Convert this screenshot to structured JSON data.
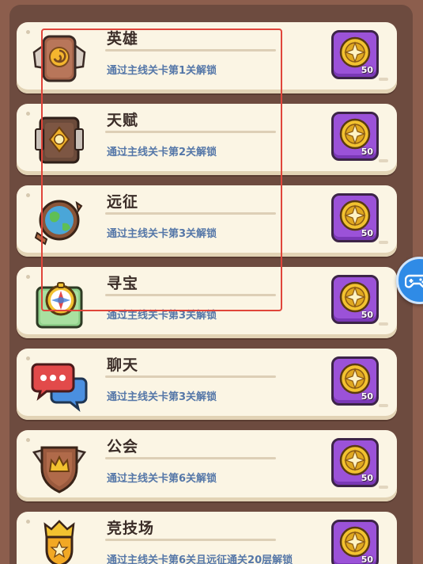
{
  "features": [
    {
      "name": "英雄",
      "desc": "通过主线关卡第1关解锁",
      "icon": "hero-icon",
      "reward_count": "50"
    },
    {
      "name": "天赋",
      "desc": "通过主线关卡第2关解锁",
      "icon": "talent-icon",
      "reward_count": "50"
    },
    {
      "name": "远征",
      "desc": "通过主线关卡第3关解锁",
      "icon": "expedition-globe-icon",
      "reward_count": "50"
    },
    {
      "name": "寻宝",
      "desc": "通过主线关卡第3关解锁",
      "icon": "treasure-hunt-compass-icon",
      "reward_count": "50"
    },
    {
      "name": "聊天",
      "desc": "通过主线关卡第3关解锁",
      "icon": "chat-bubbles-icon",
      "reward_count": "50"
    },
    {
      "name": "公会",
      "desc": "通过主线关卡第6关解锁",
      "icon": "guild-shield-icon",
      "reward_count": "50"
    },
    {
      "name": "竞技场",
      "desc": "通过主线关卡第6关且远征通关20层解锁",
      "icon": "arena-trophy-icon",
      "reward_count": "50"
    }
  ],
  "reward_icon": "gold-compass-coin-icon",
  "floating_button_icon": "gamepad-icon",
  "colors": {
    "background": "#8c5e4d",
    "row": "#fbf5e4",
    "title": "#3b2d28",
    "description": "#5577a8",
    "reward_tile": "#9b52d8",
    "highlight_frame": "#e0453a",
    "floating_button": "#2f8be6"
  }
}
